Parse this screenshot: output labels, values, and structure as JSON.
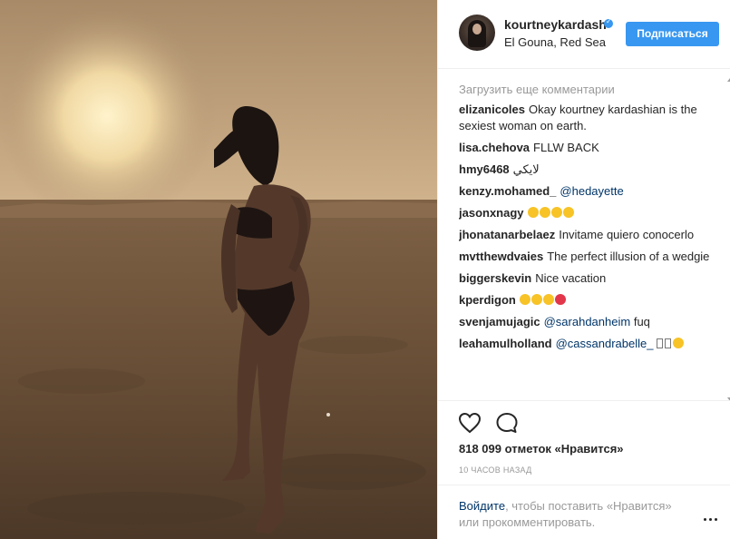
{
  "header": {
    "username": "kourtneykardash",
    "location": "El Gouna, Red Sea",
    "follow_label": "Подписаться"
  },
  "comments": {
    "load_more": "Загрузить еще комментарии",
    "items": [
      {
        "user": "elizanicoles",
        "text": "Okay kourtney kardashian is the sexiest woman on earth."
      },
      {
        "user": "lisa.chehova",
        "text": "FLLW BACK"
      },
      {
        "user": "hmy6468",
        "text": "لايكي"
      },
      {
        "user": "kenzy.mohamed_",
        "mention": "@hedayette"
      },
      {
        "user": "jasonxnagy",
        "emoji": [
          "smiley-heart-eyes",
          "smiley-heart-eyes",
          "smiley-heart-eyes",
          "smiley-heart-eyes"
        ]
      },
      {
        "user": "jhonatanarbelaez",
        "text": "Invitame quiero conocerlo"
      },
      {
        "user": "mvtthewdvaies",
        "text": "The perfect illusion of a wedgie"
      },
      {
        "user": "biggerskevin",
        "text": "Nice vacation"
      },
      {
        "user": "kperdigon",
        "emoji": [
          "smiley-heart-eyes",
          "smiley-heart-eyes",
          "smiley-heart-eyes",
          "kiss-lips"
        ]
      },
      {
        "user": "svenjamujagic",
        "mention": "@sarahdanheim",
        "text": "fuq"
      },
      {
        "user": "leahamulholland",
        "mention": "@cassandrabelle_",
        "emoji": [
          "tofu",
          "tofu",
          "smiley-heart-eyes"
        ]
      }
    ]
  },
  "actions": {
    "likes": "818 099 отметок «Нравится»",
    "time": "10 ЧАСОВ НАЗАД",
    "login_link": "Войдите",
    "login_text": ", чтобы поставить «Нравится» или прокомментировать."
  },
  "icons": {
    "like": "heart-outline-icon",
    "comment": "speech-bubble-icon",
    "more": "more-dots-icon",
    "verified": "verified-badge-icon"
  },
  "colors": {
    "accent": "#3897f0",
    "link": "#003569",
    "muted": "#999999",
    "text": "#262626"
  }
}
